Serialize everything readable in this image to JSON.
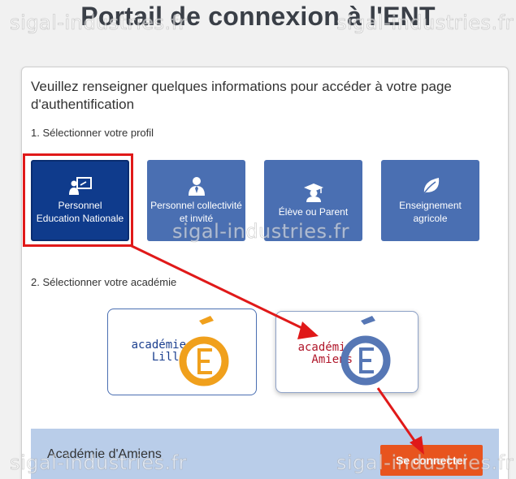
{
  "page": {
    "title": "Portail de connexion à l'ENT",
    "intro": "Veuillez renseigner quelques informations pour accéder à votre page d'authentification"
  },
  "steps": {
    "profile_label": "1. Sélectionner votre profil",
    "academy_label": "2. Sélectionner votre académie"
  },
  "profiles": [
    {
      "label": "Personnel Education Nationale",
      "icon": "teacher-board-icon",
      "selected": true
    },
    {
      "label": "Personnel collectivité et invité",
      "icon": "person-tie-icon",
      "selected": false
    },
    {
      "label": "Élève ou Parent",
      "icon": "graduation-cap-icon",
      "selected": false
    },
    {
      "label": "Enseignement agricole",
      "icon": "leaf-icon",
      "selected": false
    }
  ],
  "academies": [
    {
      "line1": "académie",
      "line2": "Lille",
      "color": "#1b3f8f",
      "e_color": "#f0a01c",
      "selected": false
    },
    {
      "line1": "académie",
      "line2": "Amiens",
      "color": "#b0162a",
      "e_color": "#5677b5",
      "selected": true
    }
  ],
  "footer": {
    "selected_academy": "Académie d'Amiens",
    "connect_label": "Se connecter"
  },
  "colors": {
    "profile_bg": "#4a6fb2",
    "profile_selected_bg": "#0f3b8c",
    "annotation": "#e01919",
    "button": "#e8541e",
    "bottom_bar": "#b9cde9"
  },
  "watermark": "sigal-industries.fr"
}
